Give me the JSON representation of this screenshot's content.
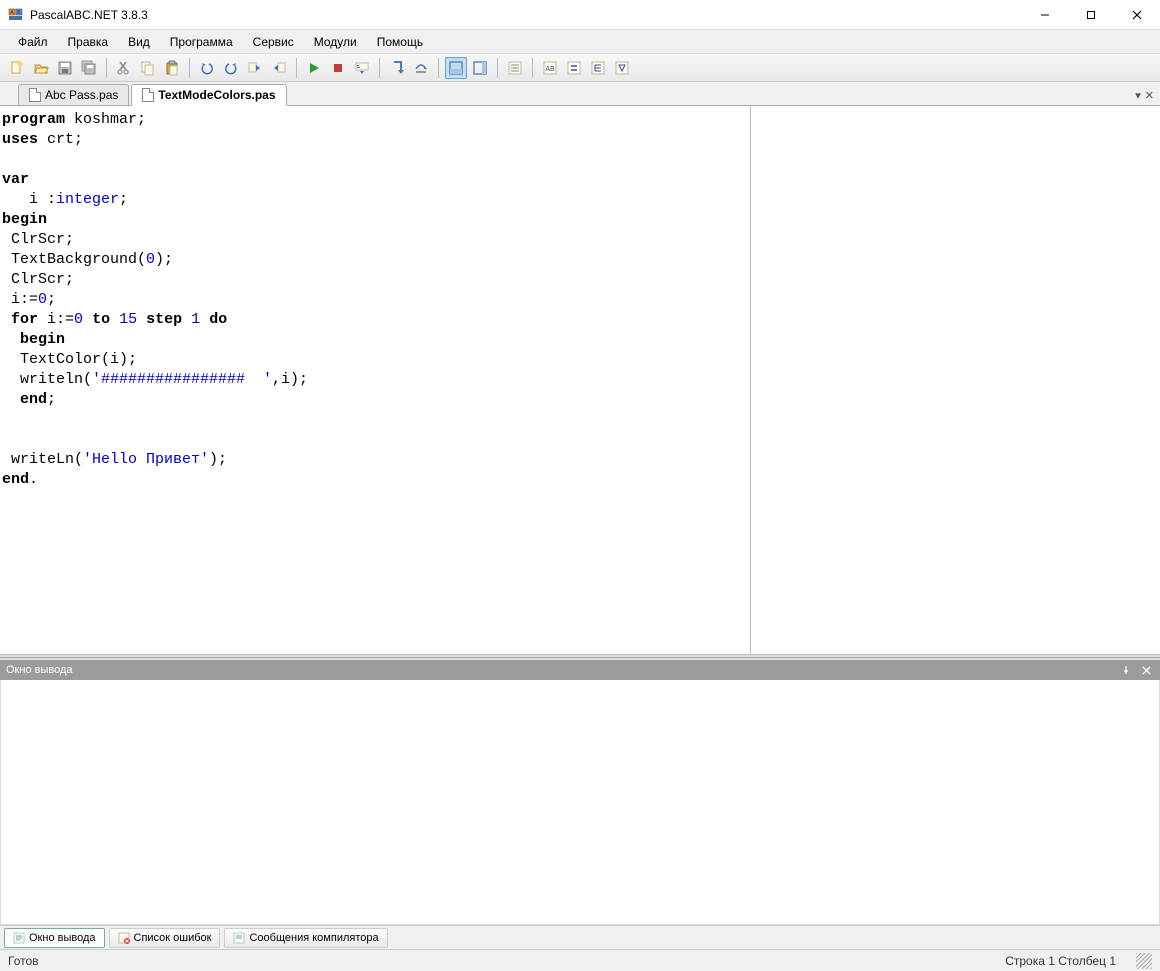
{
  "window": {
    "title": "PascalABC.NET 3.8.3"
  },
  "menu": {
    "file": "Файл",
    "edit": "Правка",
    "view": "Вид",
    "program": "Программа",
    "service": "Сервис",
    "modules": "Модули",
    "help": "Помощь"
  },
  "tabs": {
    "t0": "Abc Pass.pas",
    "t1": "TextModeColors.pas"
  },
  "output": {
    "header": "Окно вывода"
  },
  "bottomTabs": {
    "t0": "Окно вывода",
    "t1": "Список ошибок",
    "t2": "Сообщения компилятора"
  },
  "status": {
    "ready": "Готов",
    "line": "Строка 1 Столбец 1"
  },
  "code": {
    "l0a": "program",
    "l0b": " koshmar;",
    "l1a": "uses",
    "l1b": " crt;",
    "l2a": "var",
    "l3a": "   i :",
    "l3b": "integer",
    "l3c": ";",
    "l4a": "begin",
    "l5a": " ClrScr;",
    "l6a": " TextBackground(",
    "l6b": "0",
    "l6c": ");",
    "l7a": " ClrScr;",
    "l8a": " i:=",
    "l8b": "0",
    "l8c": ";",
    "l9a": " ",
    "l9b": "for",
    "l9c": " i:=",
    "l9d": "0",
    "l9e": " ",
    "l9f": "to",
    "l9g": " ",
    "l9h": "15",
    "l9i": " ",
    "l9j": "step",
    "l9k": " ",
    "l9l": "1",
    "l9m": " ",
    "l9n": "do",
    "l10a": "  ",
    "l10b": "begin",
    "l11a": "  TextColor(i);",
    "l12a": "  writeln(",
    "l12b": "'################  '",
    "l12c": ",i);",
    "l13a": "  ",
    "l13b": "end",
    "l13c": ";",
    "l14a": " writeLn(",
    "l14b": "'Hello Привет'",
    "l14c": ");",
    "l15a": "end",
    "l15b": "."
  }
}
